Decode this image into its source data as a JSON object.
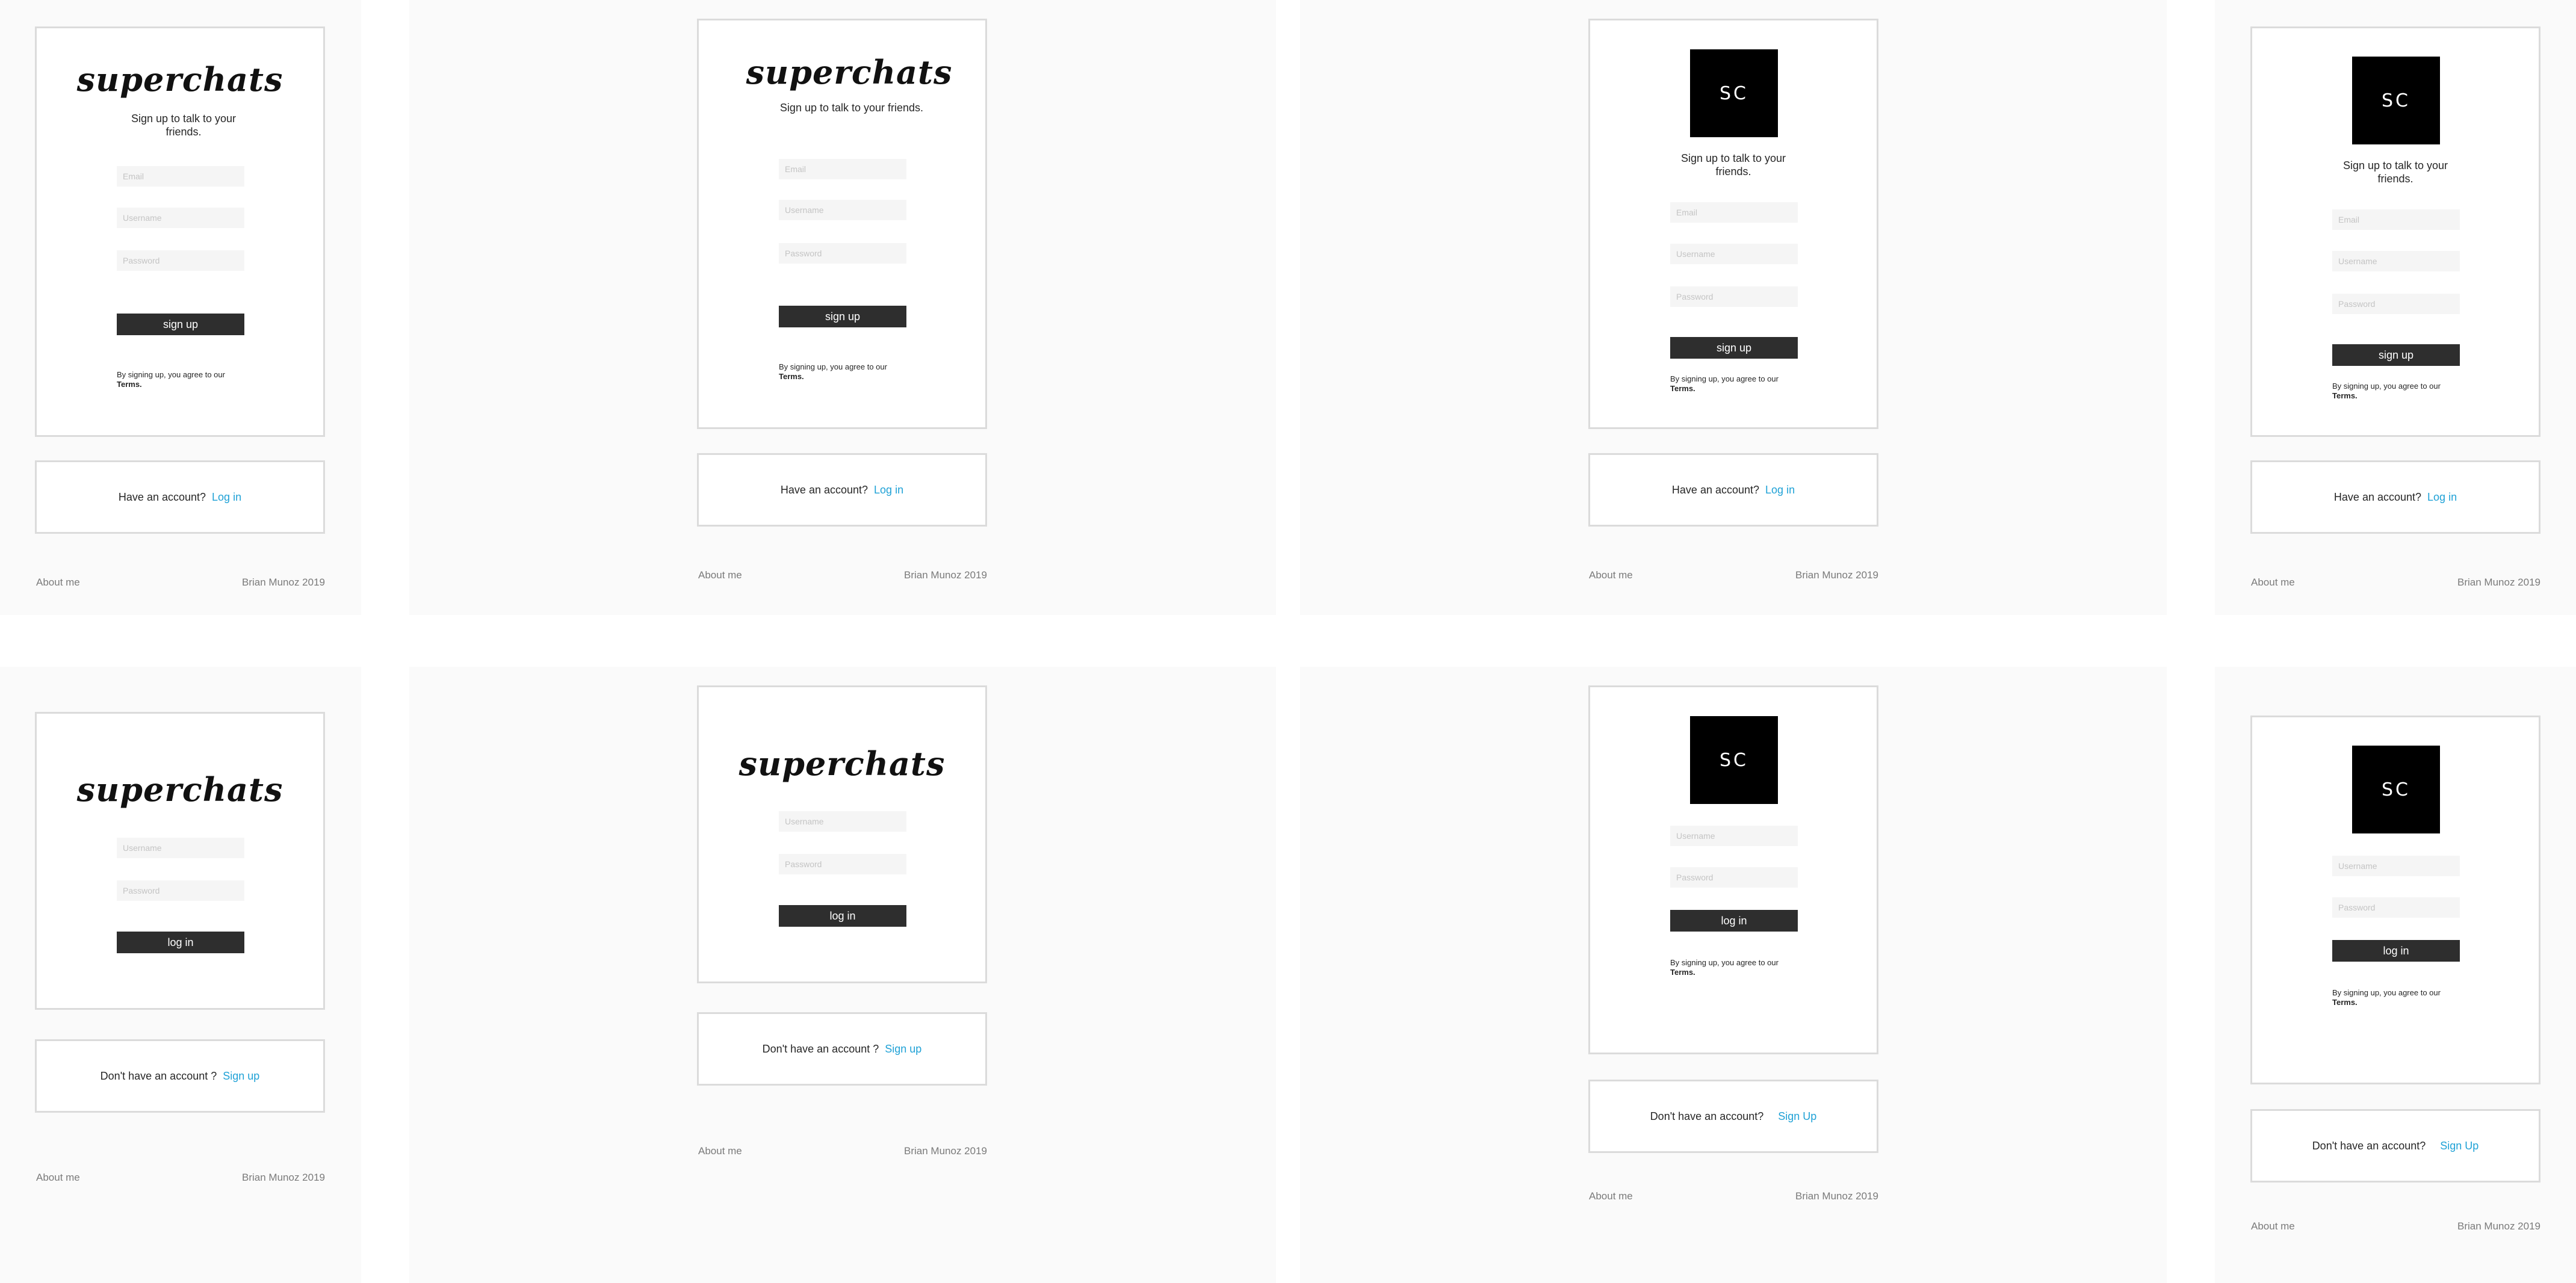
{
  "brand": {
    "wordmark": "superchats",
    "monogram": "SC"
  },
  "signup": {
    "tagline": "Sign up to talk to your friends.",
    "email_placeholder": "Email",
    "username_placeholder": "Username",
    "password_placeholder": "Password",
    "button": "sign up",
    "terms_prefix": "By signing up, you agree to our",
    "terms_link": "Terms."
  },
  "login": {
    "username_placeholder": "Username",
    "password_placeholder": "Password",
    "button": "log in"
  },
  "switch_to_login": {
    "question": "Have an account?",
    "link": "Log in"
  },
  "switch_to_signup_a": {
    "question": "Don't have an account ?",
    "link": "Sign up"
  },
  "switch_to_signup_b": {
    "question": "Don't have an account?",
    "link": "Sign Up"
  },
  "footer": {
    "about": "About me",
    "credit": "Brian Munoz 2019"
  },
  "colors": {
    "link": "#1ea1d6",
    "button": "#2e2e2e",
    "logo_box": "#000000"
  }
}
